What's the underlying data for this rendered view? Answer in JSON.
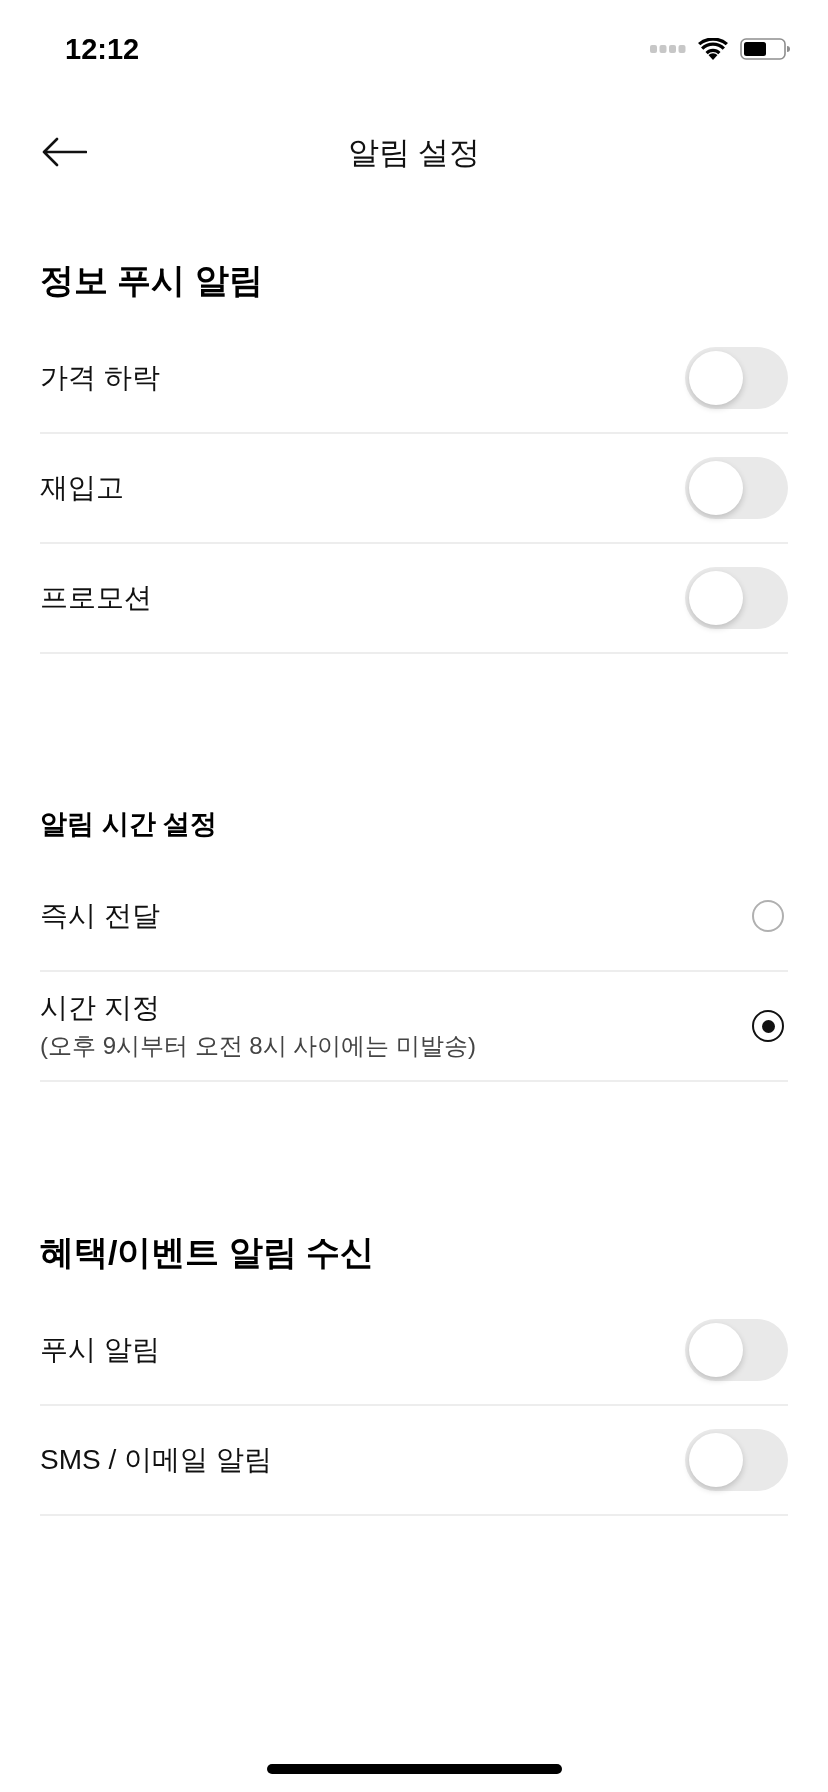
{
  "status_bar": {
    "time": "12:12"
  },
  "header": {
    "title": "알림 설정"
  },
  "sections": [
    {
      "kind": "toggles",
      "title": "정보 푸시 알림",
      "items": [
        {
          "label": "가격 하락",
          "on": false
        },
        {
          "label": "재입고",
          "on": false
        },
        {
          "label": "프로모션",
          "on": false
        }
      ]
    },
    {
      "kind": "radios",
      "title": "알림 시간 설정",
      "items": [
        {
          "label": "즉시 전달",
          "selected": false
        },
        {
          "label": "시간 지정",
          "note": "(오후 9시부터 오전 8시 사이에는 미발송)",
          "selected": true
        }
      ]
    },
    {
      "kind": "toggles",
      "title": "혜택/이벤트 알림 수신",
      "items": [
        {
          "label": "푸시 알림",
          "on": false
        },
        {
          "label": "SMS / 이메일 알림",
          "on": false
        }
      ]
    }
  ]
}
